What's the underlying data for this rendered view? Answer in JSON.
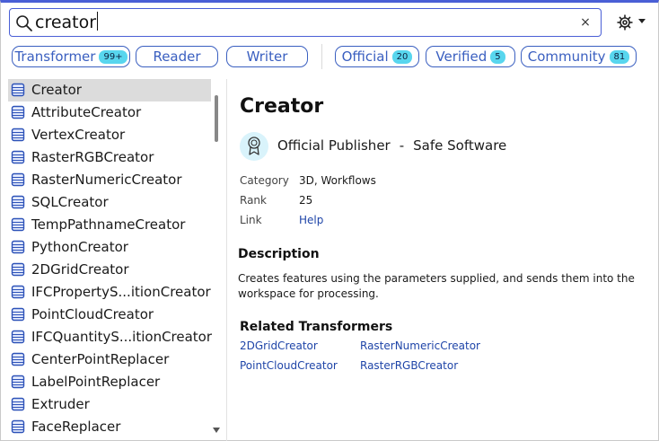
{
  "search": {
    "value": "creator",
    "clear_label": "×"
  },
  "chips": [
    {
      "label": "Transformer",
      "count": "99+"
    },
    {
      "label": "Reader",
      "count": ""
    },
    {
      "label": "Writer",
      "count": ""
    },
    {
      "label": "Official",
      "count": "20"
    },
    {
      "label": "Verified",
      "count": "5"
    },
    {
      "label": "Community",
      "count": "81"
    }
  ],
  "results": [
    "Creator",
    "AttributeCreator",
    "VertexCreator",
    "RasterRGBCreator",
    "RasterNumericCreator",
    "SQLCreator",
    "TempPathnameCreator",
    "PythonCreator",
    "2DGridCreator",
    "IFCPropertyS...itionCreator",
    "PointCloudCreator",
    "IFCQuantityS...itionCreator",
    "CenterPointReplacer",
    "LabelPointReplacer",
    "Extruder",
    "FaceReplacer"
  ],
  "selected_index": 0,
  "detail": {
    "title": "Creator",
    "publisher_type": "Official Publisher",
    "publisher_sep": "-",
    "publisher_name": "Safe Software",
    "fields": {
      "category_label": "Category",
      "category_value": "3D, Workflows",
      "rank_label": "Rank",
      "rank_value": "25",
      "link_label": "Link",
      "link_value": "Help"
    },
    "description_heading": "Description",
    "description": "Creates features using the parameters supplied, and sends them into the workspace for processing.",
    "related_heading": "Related Transformers",
    "related": [
      "2DGridCreator",
      "RasterNumericCreator",
      "PointCloudCreator",
      "RasterRGBCreator"
    ]
  },
  "colors": {
    "accent": "#4a5fd6",
    "chip_border": "#3a5fc0",
    "badge": "#58d6ee",
    "link": "#1f45a8",
    "selected_row": "#dcdcdc"
  },
  "icons": {
    "search": "search-icon",
    "settings": "gear-icon",
    "transformer": "transformer-icon",
    "publisher": "award-ribbon-icon"
  }
}
